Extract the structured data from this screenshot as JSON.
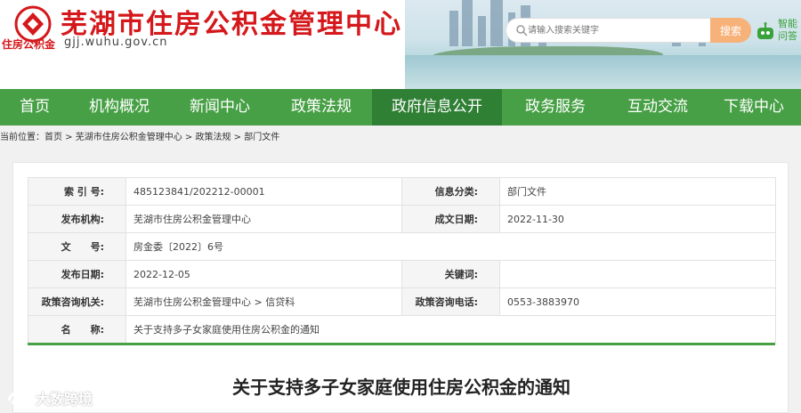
{
  "header": {
    "site_title": "芜湖市住房公积金管理中心",
    "site_url": "gjj.wuhu.gov.cn",
    "logo_caption": "住房公积金",
    "search": {
      "placeholder": "请输入搜索关键字",
      "button_label": "搜索"
    },
    "assistant_label": "智能问答"
  },
  "nav": {
    "items": [
      "首页",
      "机构概况",
      "新闻中心",
      "政策法规",
      "政府信息公开",
      "政务服务",
      "互动交流",
      "下载中心"
    ],
    "active_index": 4
  },
  "breadcrumb": {
    "prefix": "当前位置：",
    "items": [
      "首页",
      "芜湖市住房公积金管理中心",
      "政策法规",
      "部门文件"
    ],
    "separator": " > "
  },
  "meta": {
    "index_label": "索 引 号:",
    "index_value": "485123841/202212-00001",
    "category_label": "信息分类:",
    "category_value": "部门文件",
    "publisher_label": "发布机构:",
    "publisher_value": "芜湖市住房公积金管理中心",
    "created_label": "成文日期:",
    "created_value": "2022-11-30",
    "docno_label": "文　　号:",
    "docno_value": "房金委〔2022〕6号",
    "pubdate_label": "发布日期:",
    "pubdate_value": "2022-12-05",
    "keywords_label": "关键词:",
    "keywords_value": "",
    "consult_org_label": "政策咨询机关:",
    "consult_org_value": "芜湖市住房公积金管理中心 > 信贷科",
    "consult_phone_label": "政策咨询电话:",
    "consult_phone_value": "0553-3883970",
    "name_label": "名　　称:",
    "name_value": "关于支持多子女家庭使用住房公积金的通知"
  },
  "document_title": "关于支持多子女家庭使用住房公积金的通知",
  "watermark": "大数跨境",
  "colors": {
    "brand_red": "#d5181b",
    "nav_green": "#47a045",
    "nav_active": "#2f7f34",
    "search_button": "#f7b27a"
  }
}
